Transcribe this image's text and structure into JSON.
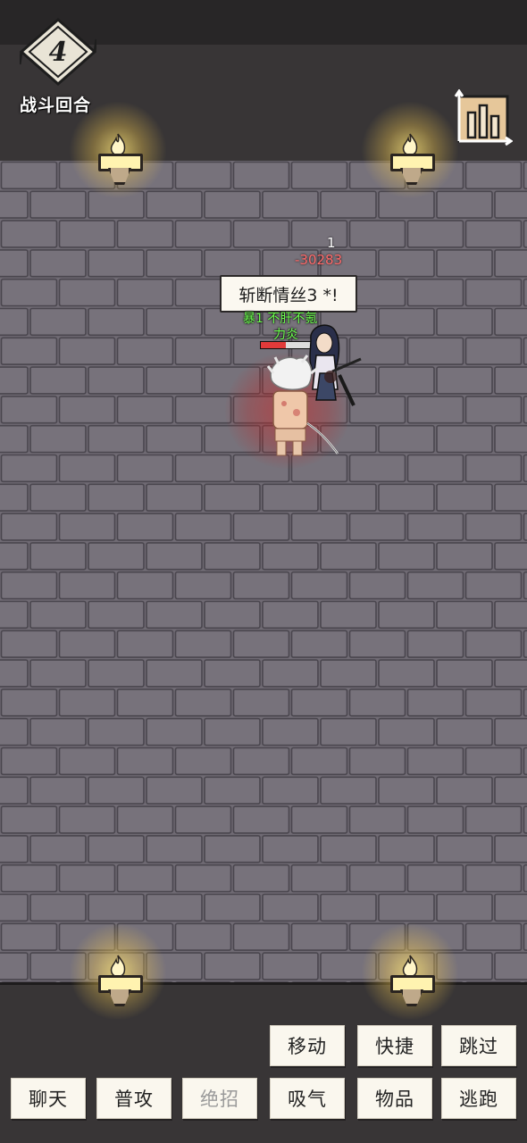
{
  "hud": {
    "round_number": "4",
    "round_label": "战斗回合"
  },
  "battle": {
    "skill_name": "斩断情丝3 *!",
    "hit_count": "1",
    "damage": "-30283",
    "status_effects": "暴1 不肝不氪",
    "status_effects_2": "力炎"
  },
  "actions": {
    "move": "移动",
    "shortcut": "快捷",
    "skip": "跳过",
    "chat": "聊天",
    "normal_attack": "普攻",
    "ultimate": "绝招",
    "absorb": "吸气",
    "items": "物品",
    "flee": "逃跑"
  },
  "colors": {
    "floor": "#6f6a73",
    "wall": "#383536",
    "damage": "#ff6b6b",
    "status": "#6dff4f"
  },
  "icons": {
    "round": "round-diamond-badge",
    "stats": "bar-chart-icon",
    "torch": "torch-icon"
  }
}
